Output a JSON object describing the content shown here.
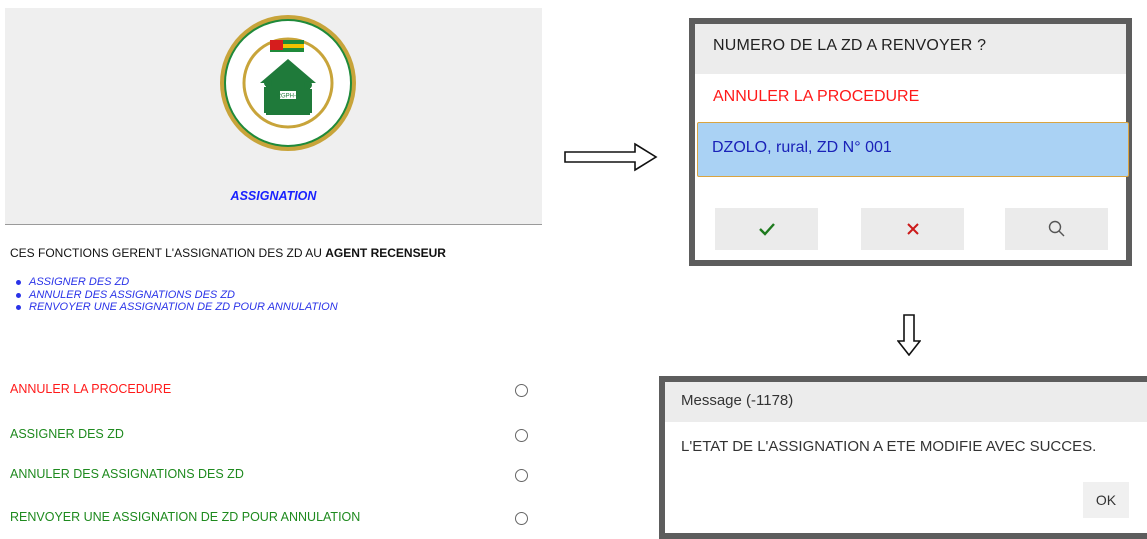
{
  "assignation_screen": {
    "logo": {
      "ring_text_top": "5ème RECENSEMENT GÉNÉRAL DE LA",
      "ring_text_bottom": "POPULATION ET DE L'HABITAT AU TOGO",
      "center_badge": "RGPH-5"
    },
    "title": "ASSIGNATION",
    "description_prefix": "CES FONCTIONS GERENT L'ASSIGNATION DES ZD AU ",
    "description_bold": "AGENT RECENSEUR",
    "bullets": [
      "ASSIGNER DES ZD",
      "ANNULER DES ASSIGNATIONS DES ZD",
      "RENVOYER UNE ASSIGNATION DE ZD POUR ANNULATION"
    ],
    "options": [
      {
        "label": "ANNULER LA PROCEDURE"
      },
      {
        "label": "ASSIGNER DES ZD"
      },
      {
        "label": "ANNULER DES ASSIGNATIONS DES ZD"
      },
      {
        "label": "RENVOYER UNE ASSIGNATION DE ZD POUR ANNULATION"
      }
    ]
  },
  "zd_dialog": {
    "title": "NUMERO DE LA ZD A RENVOYER ?",
    "cancel_option": "ANNULER LA PROCEDURE",
    "selected_option": "DZOLO, rural, ZD N° 001",
    "buttons": [
      "check-icon",
      "close-icon",
      "search-icon"
    ]
  },
  "message_dialog": {
    "title": "Message (-1178)",
    "body": "L'ETAT DE L'ASSIGNATION A ETE MODIFIE AVEC SUCCES.",
    "ok_label": "OK"
  },
  "colors": {
    "title_blue": "#1a22ff",
    "cancel_red": "#ff1a1a",
    "option_green": "#1e8a1e",
    "selected_bg": "#aad2f4"
  }
}
